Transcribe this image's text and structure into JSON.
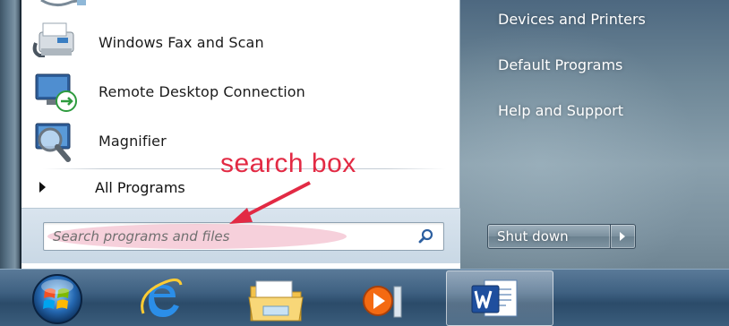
{
  "start_menu": {
    "programs": [
      {
        "label": "Windows Fax and Scan",
        "icon": "fax-scanner-icon"
      },
      {
        "label": "Remote Desktop Connection",
        "icon": "remote-desktop-icon"
      },
      {
        "label": "Magnifier",
        "icon": "magnifier-icon"
      }
    ],
    "all_programs_label": "All Programs",
    "search": {
      "placeholder": "Search programs and files"
    },
    "right_items": [
      "Devices and Printers",
      "Default Programs",
      "Help and Support"
    ],
    "shutdown_label": "Shut down"
  },
  "annotation": {
    "text": "search box",
    "color": "#e22a44"
  },
  "taskbar": {
    "items": [
      "start-orb-icon",
      "internet-explorer-icon",
      "windows-explorer-icon",
      "media-player-icon",
      "word-icon"
    ]
  }
}
